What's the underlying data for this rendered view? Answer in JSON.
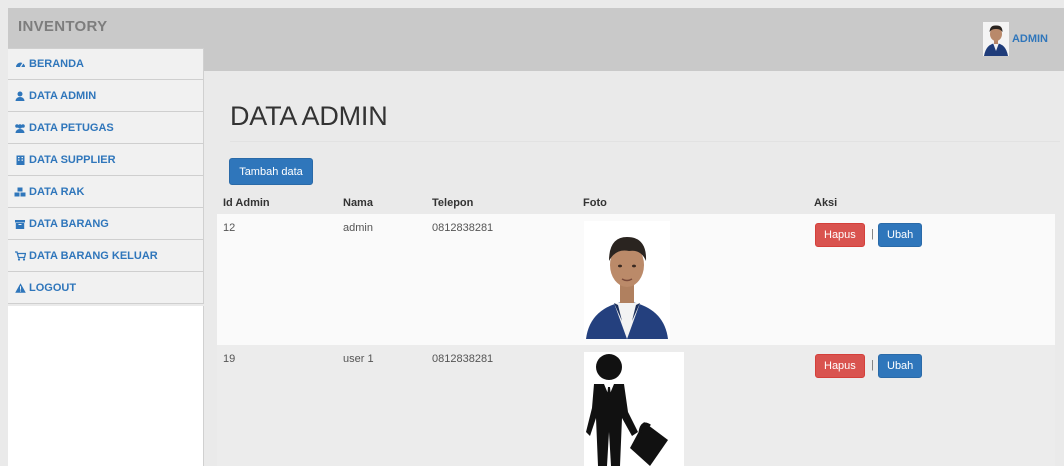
{
  "app": {
    "brand": "INVENTORY"
  },
  "user": {
    "name": "ADMIN"
  },
  "sidebar": {
    "items": [
      {
        "label": "BERANDA",
        "icon": "dashboard-icon"
      },
      {
        "label": "DATA ADMIN",
        "icon": "user-icon"
      },
      {
        "label": "DATA PETUGAS",
        "icon": "users-icon"
      },
      {
        "label": "DATA SUPPLIER",
        "icon": "building-icon"
      },
      {
        "label": "DATA RAK",
        "icon": "cubes-icon"
      },
      {
        "label": "DATA BARANG",
        "icon": "archive-icon"
      },
      {
        "label": "DATA BARANG KELUAR",
        "icon": "cart-icon"
      },
      {
        "label": "LOGOUT",
        "icon": "warning-icon"
      }
    ]
  },
  "main": {
    "title": "DATA ADMIN",
    "add_button": "Tambah data",
    "table": {
      "headers": [
        "Id Admin",
        "Nama",
        "Telepon",
        "Foto",
        "Aksi"
      ],
      "rows": [
        {
          "id": "12",
          "name": "admin",
          "phone": "0812838281",
          "photo": "person-photo",
          "delete": "Hapus",
          "sep": "|",
          "edit": "Ubah"
        },
        {
          "id": "19",
          "name": "user 1",
          "phone": "0812838281",
          "photo": "businessman-silhouette",
          "delete": "Hapus",
          "sep": "|",
          "edit": "Ubah"
        }
      ]
    }
  },
  "colors": {
    "primary": "#2f76bb",
    "danger": "#d9534f",
    "header_bg": "#c9c9c9"
  }
}
